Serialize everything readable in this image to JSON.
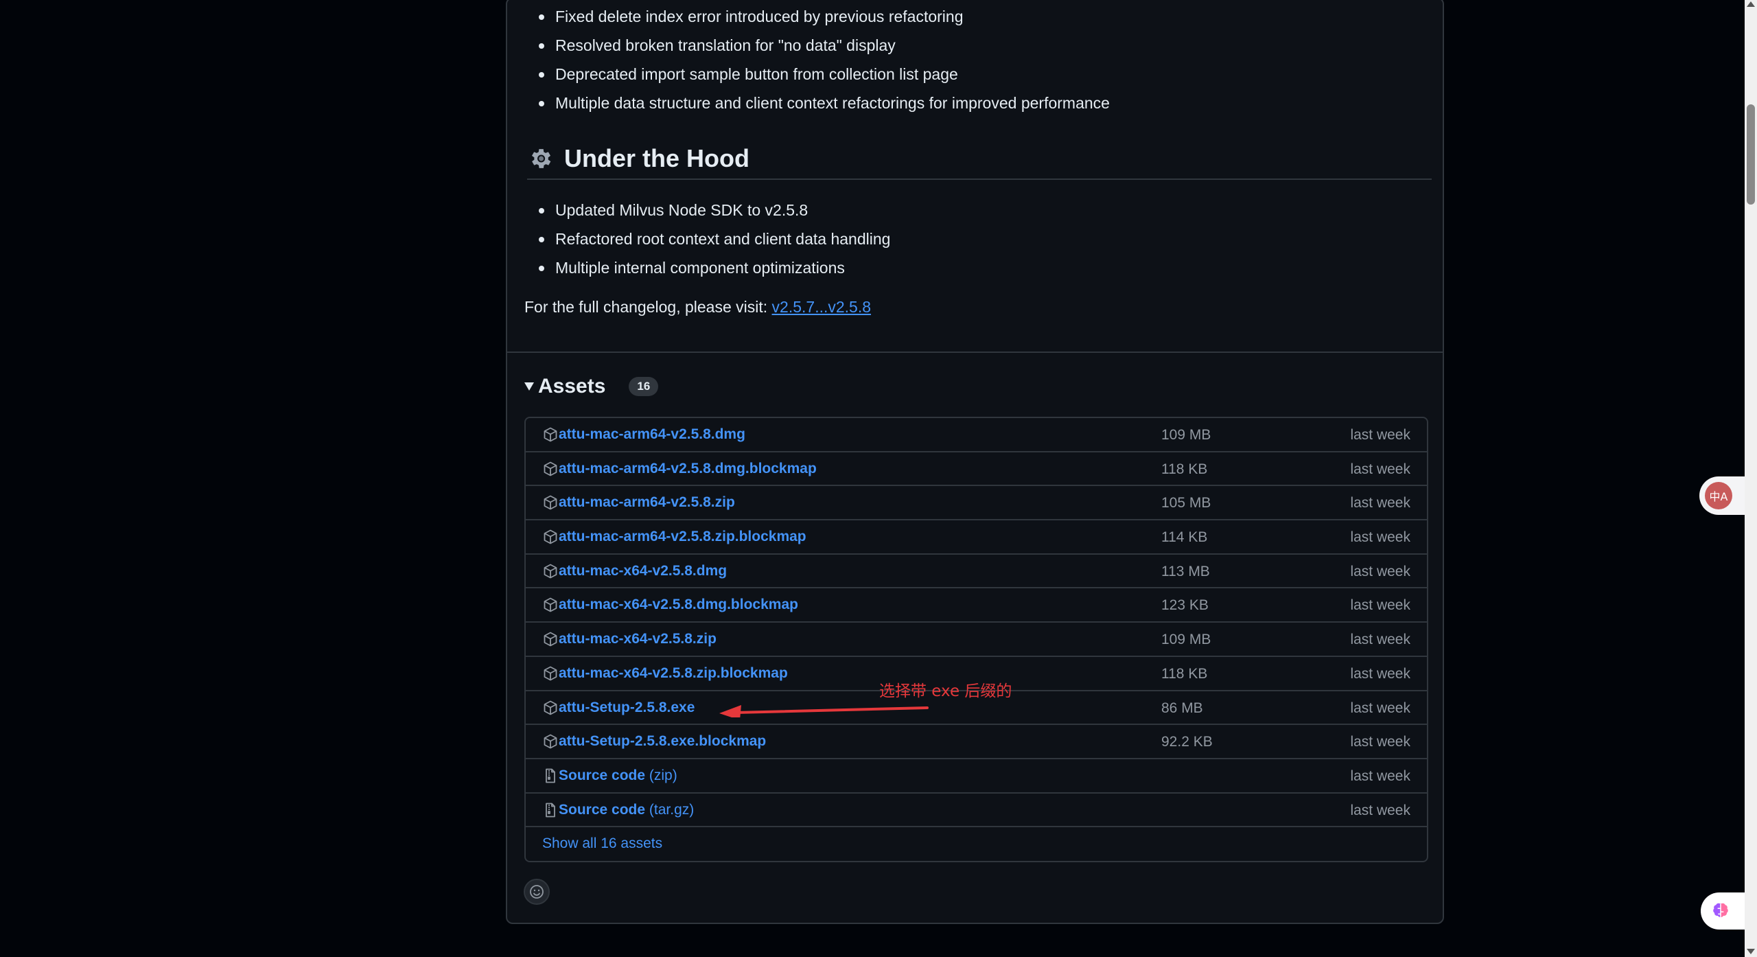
{
  "release_notes": {
    "fix_items": [
      "Fixed delete index error introduced by previous refactoring",
      "Resolved broken translation for \"no data\" display",
      "Deprecated import sample button from collection list page",
      "Multiple data structure and client context refactorings for improved performance"
    ],
    "under_hood": {
      "title": "Under the Hood",
      "items": [
        "Updated Milvus Node SDK to v2.5.8",
        "Refactored root context and client data handling",
        "Multiple internal component optimizations"
      ]
    },
    "changelog": {
      "prefix": "For the full changelog, please visit:",
      "link": "v2.5.7...v2.5.8"
    }
  },
  "assets": {
    "title": "Assets",
    "count": "16",
    "rows": [
      {
        "name": "attu-mac-arm64-v2.5.8.dmg",
        "size": "109 MB",
        "date": "last week"
      },
      {
        "name": "attu-mac-arm64-v2.5.8.dmg.blockmap",
        "size": "118 KB",
        "date": "last week"
      },
      {
        "name": "attu-mac-arm64-v2.5.8.zip",
        "size": "105 MB",
        "date": "last week"
      },
      {
        "name": "attu-mac-arm64-v2.5.8.zip.blockmap",
        "size": "114 KB",
        "date": "last week"
      },
      {
        "name": "attu-mac-x64-v2.5.8.dmg",
        "size": "113 MB",
        "date": "last week"
      },
      {
        "name": "attu-mac-x64-v2.5.8.dmg.blockmap",
        "size": "123 KB",
        "date": "last week"
      },
      {
        "name": "attu-mac-x64-v2.5.8.zip",
        "size": "109 MB",
        "date": "last week"
      },
      {
        "name": "attu-mac-x64-v2.5.8.zip.blockmap",
        "size": "118 KB",
        "date": "last week"
      },
      {
        "name": "attu-Setup-2.5.8.exe",
        "size": "86 MB",
        "date": "last week"
      },
      {
        "name": "attu-Setup-2.5.8.exe.blockmap",
        "size": "92.2 KB",
        "date": "last week"
      }
    ],
    "source_rows": [
      {
        "name": "Source code",
        "suffix": "(zip)",
        "date": "last week"
      },
      {
        "name": "Source code",
        "suffix": "(tar.gz)",
        "date": "last week"
      }
    ],
    "show_all": "Show all 16 assets"
  },
  "annotation": {
    "text": "选择带 exe 后缀的",
    "color": "#e5383b"
  },
  "floating": {
    "translate_label": "中A"
  },
  "colors": {
    "link": "#4493f8",
    "background": "#0d1117",
    "muted": "#9198a1"
  }
}
